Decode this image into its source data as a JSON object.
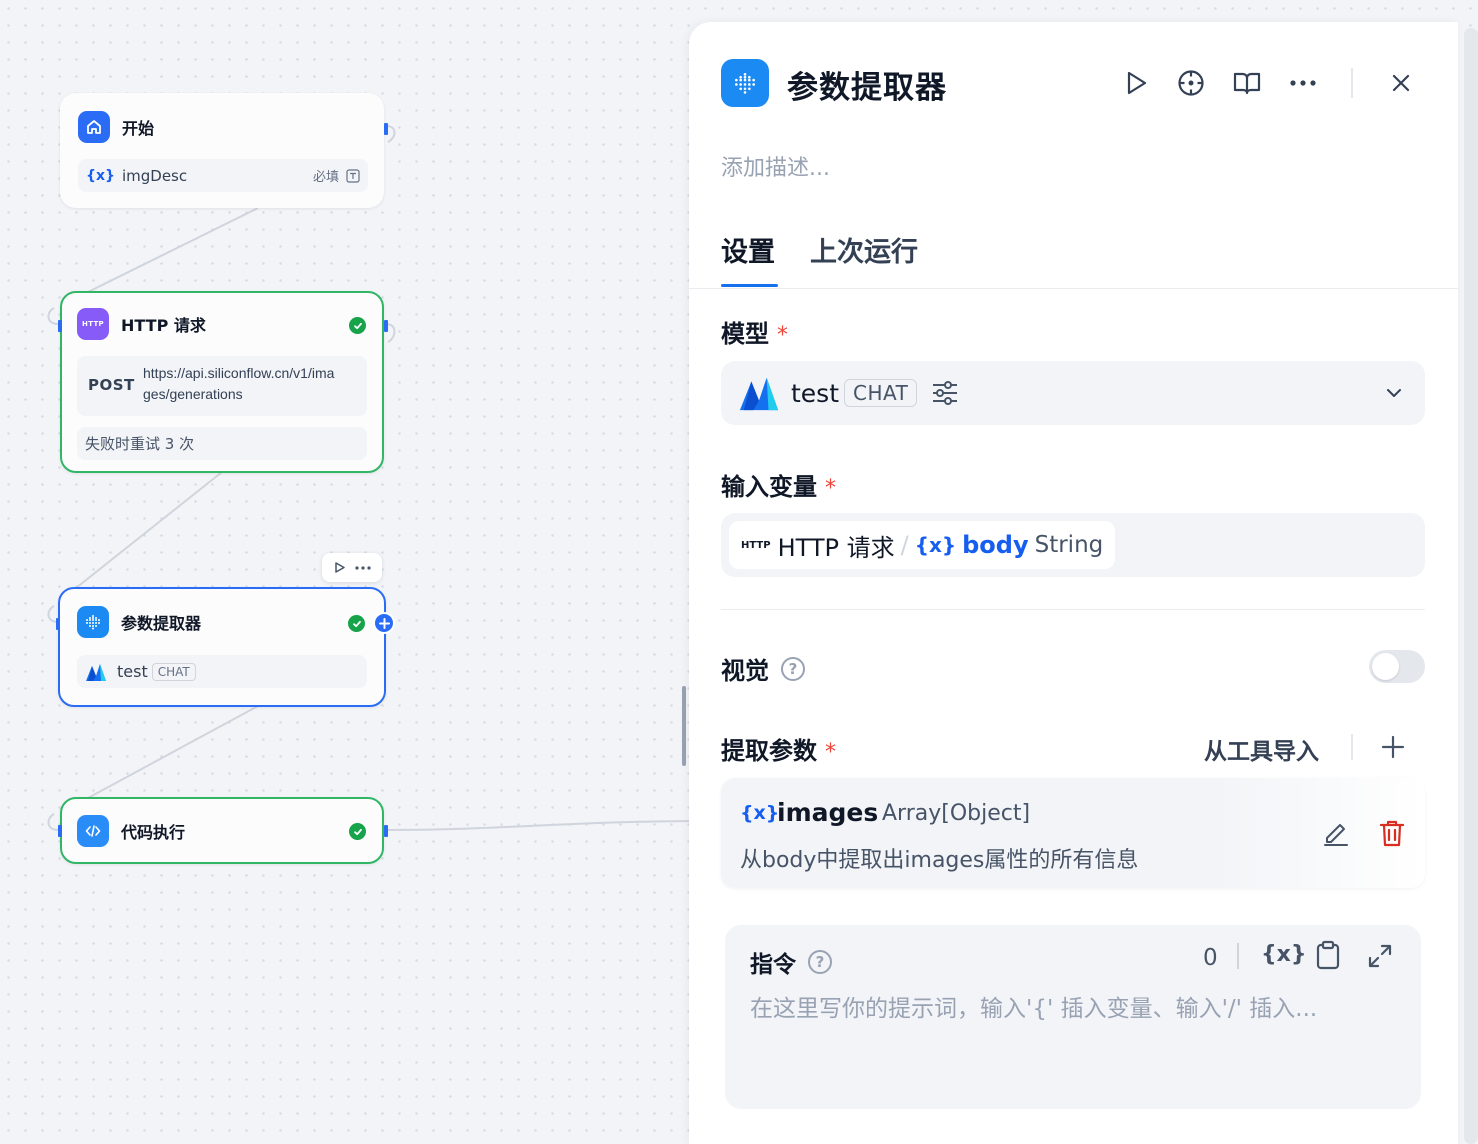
{
  "canvas": {
    "nodes": {
      "start": {
        "title": "开始",
        "var_icon": "{x}",
        "var_name": "imgDesc",
        "required_label": "必填"
      },
      "http": {
        "title": "HTTP 请求",
        "icon_text": "HTTP",
        "method": "POST",
        "url_line1": "https://api.siliconflow.cn/v1/ima",
        "url_line2": "ges/generations",
        "retry": "失败时重试 3 次"
      },
      "extractor": {
        "title": "参数提取器",
        "model_name": "test",
        "model_tag": "CHAT"
      },
      "code": {
        "title": "代码执行"
      }
    }
  },
  "panel": {
    "title": "参数提取器",
    "description_placeholder": "添加描述...",
    "tabs": [
      {
        "label": "设置",
        "active": true
      },
      {
        "label": "上次运行",
        "active": false
      }
    ],
    "model": {
      "label": "模型",
      "required": "*",
      "name": "test",
      "tag": "CHAT"
    },
    "input_var": {
      "label": "输入变量",
      "required": "*",
      "source_icon_text": "HTTP",
      "source_node": "HTTP 请求",
      "separator": "/",
      "var_icon": "{x}",
      "var_name": "body",
      "var_type": "String"
    },
    "vision": {
      "label": "视觉",
      "help_icon": "?",
      "enabled": false
    },
    "extract_params": {
      "label": "提取参数",
      "required": "*",
      "import_label": "从工具导入",
      "add_icon": "plus-icon",
      "items": [
        {
          "var_icon": "{x}",
          "name": "images",
          "type": "Array[Object]",
          "description": "从body中提取出images属性的所有信息"
        }
      ]
    },
    "instruction": {
      "label": "指令",
      "help_icon": "?",
      "count": "0",
      "var_button": "{x}",
      "placeholder": "在这里写你的提示词，输入'{' 插入变量、输入'/' 插入..."
    }
  },
  "colors": {
    "accent": "#2a6cf5",
    "success": "#31b665",
    "danger": "#d92d20",
    "variable_blue": "#155eef"
  }
}
